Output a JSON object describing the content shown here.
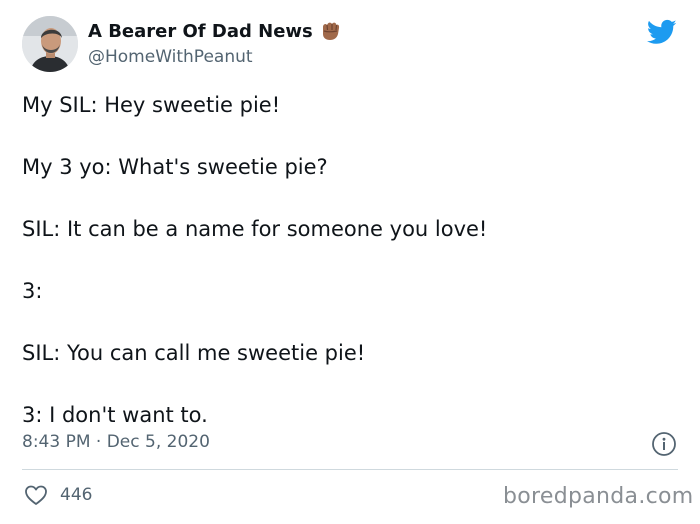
{
  "author": {
    "display_name": "A Bearer Of Dad News",
    "handle": "@HomeWithPeanut"
  },
  "icons": {
    "avatar": "avatar-photo",
    "emoji": "raised-fist-icon",
    "brand": "twitter-bird-icon",
    "info": "info-icon",
    "like": "heart-icon"
  },
  "colors": {
    "twitter_blue": "#1d9bf0",
    "secondary_text": "#536471",
    "emoji_skin": "#a0694a"
  },
  "tweet": {
    "lines": [
      "My SIL: Hey sweetie pie!",
      "My 3 yo: What's sweetie pie?",
      "SIL: It can be a name for someone you love!",
      "3:",
      "SIL: You can call me sweetie pie!",
      "3: I don't want to."
    ],
    "timestamp": "8:43 PM · Dec 5, 2020",
    "likes": "446"
  },
  "watermark": "boredpanda.com"
}
